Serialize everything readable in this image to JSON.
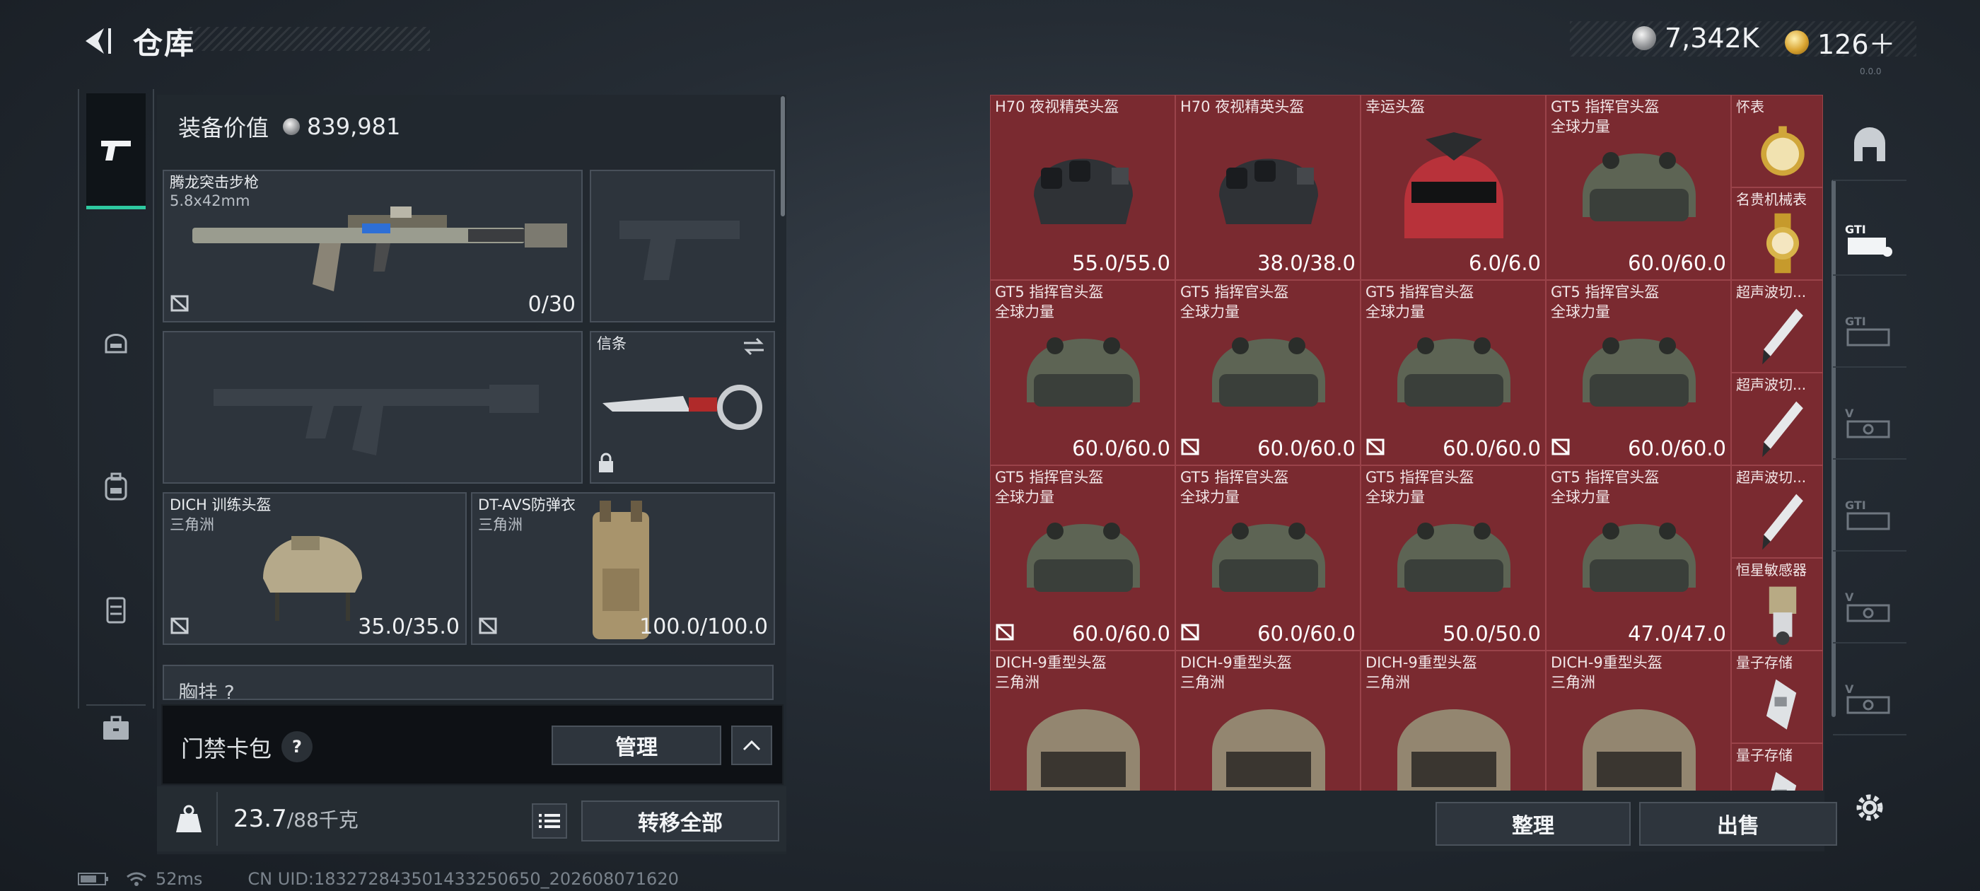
{
  "header": {
    "title": "仓库",
    "currency_silver": "7,342K",
    "currency_gold": "126＋",
    "version": "0.0.0"
  },
  "equipment": {
    "value_label": "装备价值",
    "value": "839,981",
    "slots": {
      "primary": {
        "name": "腾龙突击步枪",
        "sub": "5.8x42mm",
        "value": "0/30"
      },
      "pistol": {
        "name": "",
        "sub": "",
        "value": ""
      },
      "secondary": {
        "name": "",
        "sub": "",
        "value": ""
      },
      "melee": {
        "name": "信条",
        "sub": "",
        "value": ""
      },
      "helmet": {
        "name": "DICH 训练头盔",
        "sub": "三角洲",
        "value": "35.0/35.0"
      },
      "armor": {
        "name": "DT-AVS防弹衣",
        "sub": "三角洲",
        "value": "100.0/100.0"
      }
    },
    "chest_rig_label": "胸挂 ?"
  },
  "keycard": {
    "label": "门禁卡包",
    "help": "?",
    "manage_label": "管理"
  },
  "capacity": {
    "current": "23.7",
    "max": "/88千克",
    "kg_label": "KG",
    "transfer_label": "转移全部"
  },
  "status": {
    "ping": "52ms",
    "uid": "CN UID:183272843501433250650_202608071620"
  },
  "warehouse": {
    "rows": [
      [
        {
          "name": "H70 夜视精英头盔",
          "sub": "",
          "value": "55.0/55.0",
          "locked": false,
          "icon": "nv-helmet-icon"
        },
        {
          "name": "H70 夜视精英头盔",
          "sub": "",
          "value": "38.0/38.0",
          "locked": false,
          "icon": "nv-helmet-icon"
        },
        {
          "name": "幸运头盔",
          "sub": "",
          "value": "6.0/6.0",
          "locked": false,
          "icon": "red-helmet-icon"
        },
        {
          "name": "GT5 指挥官头盔",
          "sub": "全球力量",
          "value": "60.0/60.0",
          "locked": false,
          "icon": "gt5-helmet-icon"
        }
      ],
      [
        {
          "name": "GT5 指挥官头盔",
          "sub": "全球力量",
          "value": "60.0/60.0",
          "locked": false,
          "icon": "gt5-helmet-icon"
        },
        {
          "name": "GT5 指挥官头盔",
          "sub": "全球力量",
          "value": "60.0/60.0",
          "locked": true,
          "icon": "gt5-helmet-icon"
        },
        {
          "name": "GT5 指挥官头盔",
          "sub": "全球力量",
          "value": "60.0/60.0",
          "locked": true,
          "icon": "gt5-helmet-icon"
        },
        {
          "name": "GT5 指挥官头盔",
          "sub": "全球力量",
          "value": "60.0/60.0",
          "locked": true,
          "icon": "gt5-helmet-icon"
        }
      ],
      [
        {
          "name": "GT5 指挥官头盔",
          "sub": "全球力量",
          "value": "60.0/60.0",
          "locked": true,
          "icon": "gt5-helmet-icon"
        },
        {
          "name": "GT5 指挥官头盔",
          "sub": "全球力量",
          "value": "60.0/60.0",
          "locked": true,
          "icon": "gt5-helmet-icon"
        },
        {
          "name": "GT5 指挥官头盔",
          "sub": "全球力量",
          "value": "50.0/50.0",
          "locked": false,
          "icon": "gt5-helmet-icon"
        },
        {
          "name": "GT5 指挥官头盔",
          "sub": "全球力量",
          "value": "47.0/47.0",
          "locked": false,
          "icon": "gt5-helmet-icon"
        }
      ],
      [
        {
          "name": "DICH-9重型头盔",
          "sub": "三角洲",
          "value": "",
          "locked": false,
          "icon": "dich9-helmet-icon"
        },
        {
          "name": "DICH-9重型头盔",
          "sub": "三角洲",
          "value": "",
          "locked": false,
          "icon": "dich9-helmet-icon"
        },
        {
          "name": "DICH-9重型头盔",
          "sub": "三角洲",
          "value": "",
          "locked": false,
          "icon": "dich9-helmet-icon"
        },
        {
          "name": "DICH-9重型头盔",
          "sub": "三角洲",
          "value": "",
          "locked": false,
          "icon": "dich9-helmet-icon"
        }
      ]
    ],
    "small_items": [
      {
        "name": "怀表",
        "icon": "pocket-watch-icon"
      },
      {
        "name": "名贵机械表",
        "icon": "wristwatch-icon"
      },
      {
        "name": "超声波切...",
        "icon": "ultrasonic-cutter-icon"
      },
      {
        "name": "超声波切...",
        "icon": "ultrasonic-cutter-icon"
      },
      {
        "name": "超声波切...",
        "icon": "ultrasonic-cutter-icon"
      },
      {
        "name": "恒星敏感器",
        "icon": "star-sensor-icon"
      },
      {
        "name": "量子存储",
        "icon": "quantum-storage-icon"
      },
      {
        "name": "量子存储",
        "icon": "quantum-storage-icon"
      }
    ],
    "sort_label": "整理",
    "sell_label": "出售"
  },
  "colors": {
    "accent": "#2ec9a0",
    "cell_red": "#7a2a30",
    "panel": "#22282f"
  }
}
